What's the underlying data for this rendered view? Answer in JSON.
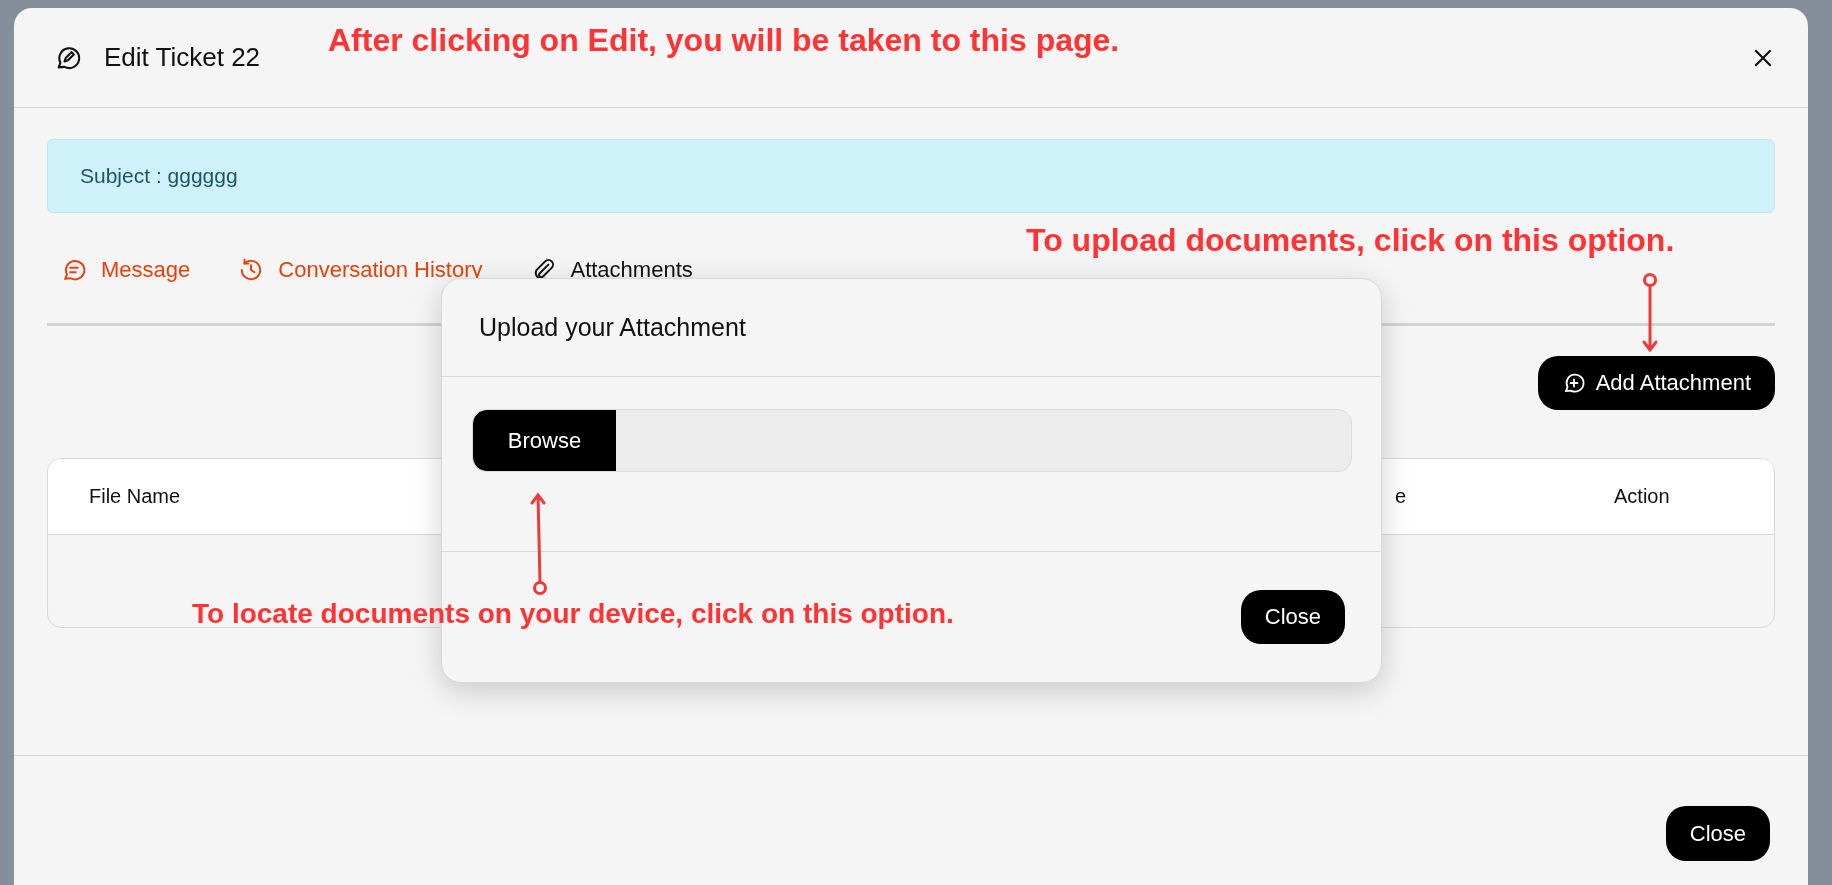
{
  "dialog": {
    "title": "Edit Ticket 22"
  },
  "subject": {
    "label": "Subject :",
    "value": "gggggg"
  },
  "tabs": [
    {
      "label": "Message",
      "selected": false
    },
    {
      "label": "Conversation History",
      "selected": false
    },
    {
      "label": "Attachments",
      "selected": true
    }
  ],
  "add_button": "Add Attachment",
  "table": {
    "columns": [
      "File Name",
      "e",
      "Action"
    ]
  },
  "footer": {
    "close": "Close"
  },
  "upload_modal": {
    "title": "Upload your Attachment",
    "browse": "Browse",
    "close": "Close"
  },
  "annotations": [
    {
      "text": "After clicking on Edit, you will be taken to this page."
    },
    {
      "text": "To upload documents, click on this option."
    },
    {
      "text": "To locate documents on your device, click on this option."
    }
  ]
}
